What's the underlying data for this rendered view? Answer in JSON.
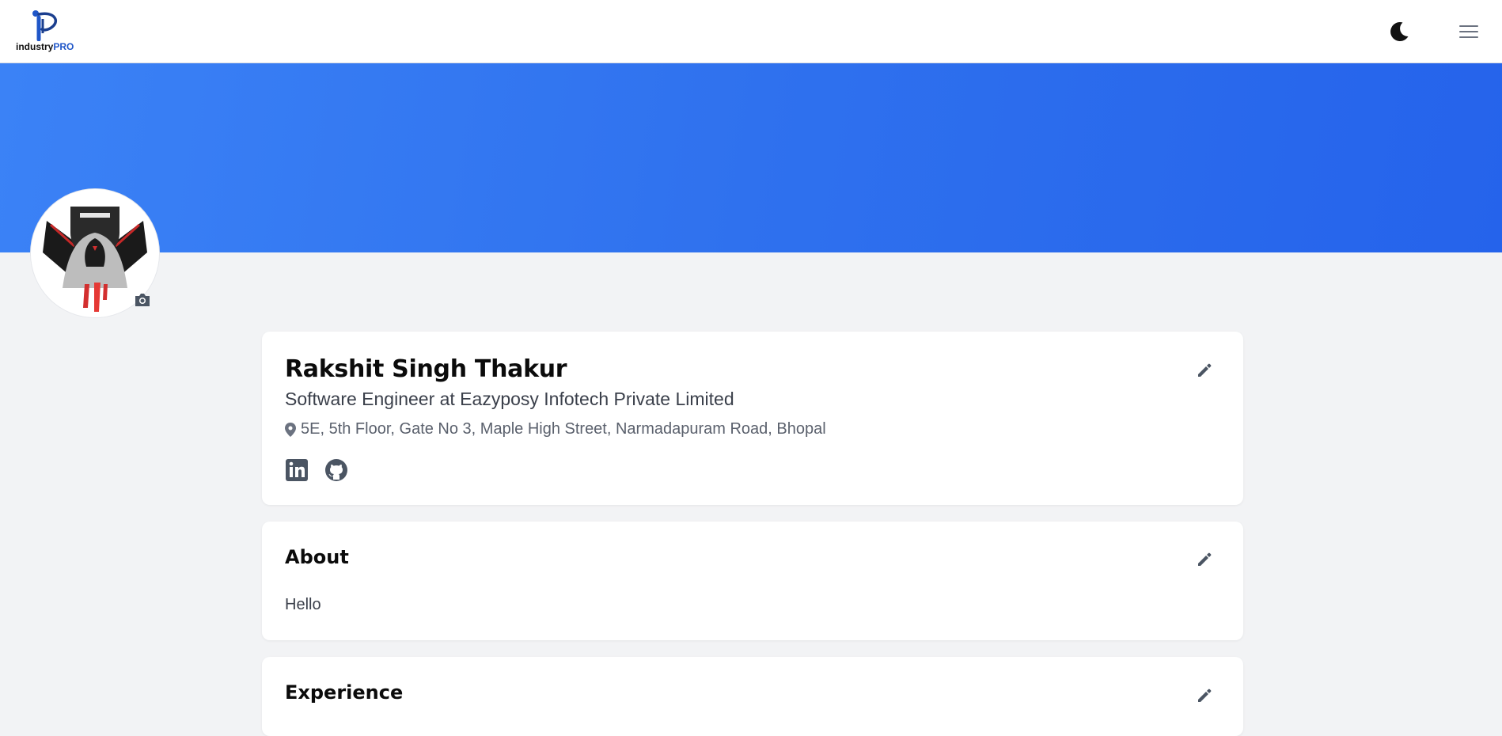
{
  "navbar": {
    "logo_text_part1": "industry",
    "logo_text_part2": "PRO",
    "brand_color": "#1f56c8",
    "theme_toggle_icon": "moon-icon",
    "menu_icon": "hamburger-menu-icon"
  },
  "banner": {
    "gradient_colors": [
      "#3b82f6",
      "#2563eb"
    ]
  },
  "profile": {
    "avatar_icon": "avatar",
    "camera_icon": "camera-icon",
    "name": "Rakshit Singh Thakur",
    "headline": "Software Engineer at Eazyposy Infotech Private Limited",
    "location": "5E, 5th Floor, Gate No 3, Maple High Street, Narmadapuram Road, Bhopal",
    "socials": [
      "linkedin-icon",
      "github-icon"
    ],
    "edit_icon": "pencil-icon"
  },
  "about": {
    "title": "About",
    "text": "Hello"
  },
  "experience": {
    "title": "Experience"
  }
}
